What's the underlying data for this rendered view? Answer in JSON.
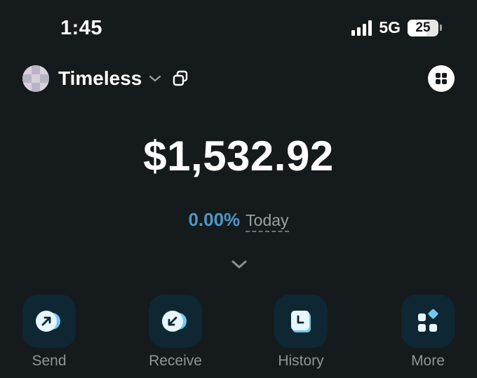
{
  "status_bar": {
    "time": "1:45",
    "network": "5G",
    "battery": "25"
  },
  "header": {
    "wallet_name": "Timeless",
    "icons": [
      "avatar",
      "chevron-down-icon",
      "copy-icon",
      "apps-grid-icon"
    ]
  },
  "balance": {
    "amount": "$1,532.92",
    "change_percent": "0.00%",
    "change_period": "Today"
  },
  "actions": [
    {
      "label": "Send",
      "icon": "arrow-up-right-icon"
    },
    {
      "label": "Receive",
      "icon": "arrow-down-left-icon"
    },
    {
      "label": "History",
      "icon": "clock-document-icon"
    },
    {
      "label": "More",
      "icon": "grid-more-icon"
    }
  ],
  "colors": {
    "background": "#151a1c",
    "accent": "#4c97c4",
    "action_tile": "#0f2733",
    "icon_light": "#e6f6fc",
    "icon_blue": "#6fc8ef",
    "label_gray": "#8f9598"
  }
}
